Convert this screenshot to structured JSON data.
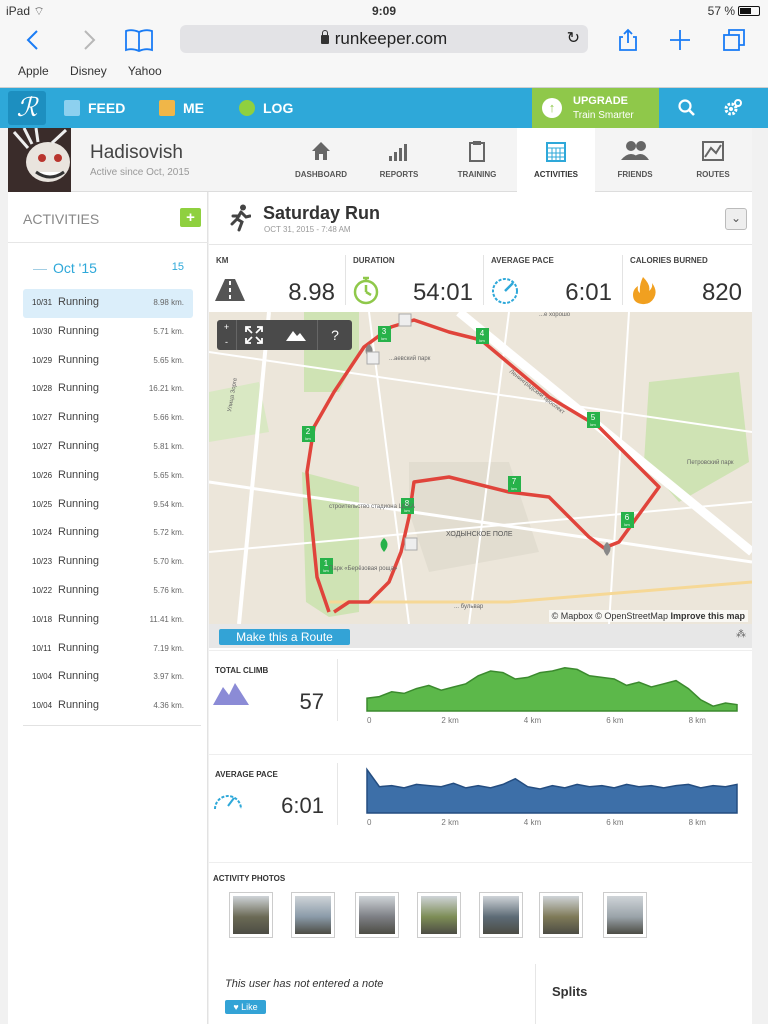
{
  "device": {
    "carrier": "iPad",
    "time": "9:09",
    "battery": "57 %",
    "battery_level": 0.57
  },
  "browser": {
    "url": "runkeeper.com",
    "bookmarks": [
      "Apple",
      "Disney",
      "Yahoo"
    ]
  },
  "header": {
    "nav": [
      {
        "label": "FEED",
        "icon": "feed-icon"
      },
      {
        "label": "ME",
        "icon": "me-icon"
      },
      {
        "label": "LOG",
        "icon": "log-icon"
      }
    ],
    "upgrade": {
      "title": "UPGRADE",
      "subtitle": "Train Smarter"
    },
    "colors": {
      "brand": "#2ea8d9",
      "upgrade": "#8fc84a",
      "route": "#d9403a",
      "climb": "#5cb84a",
      "pace": "#3d6fa8"
    }
  },
  "profile": {
    "name": "Hadisovish",
    "since": "Active since Oct, 2015"
  },
  "tabs": [
    {
      "label": "DASHBOARD",
      "icon": "home-icon"
    },
    {
      "label": "REPORTS",
      "icon": "bar-chart-icon"
    },
    {
      "label": "TRAINING",
      "icon": "clipboard-icon"
    },
    {
      "label": "ACTIVITIES",
      "icon": "calendar-icon",
      "active": true
    },
    {
      "label": "FRIENDS",
      "icon": "people-icon"
    },
    {
      "label": "ROUTES",
      "icon": "map-icon"
    }
  ],
  "sidebar": {
    "title": "ACTIVITIES",
    "add_label": "+",
    "month": {
      "label": "Oct '15",
      "count": "15",
      "prefix": "—"
    },
    "activities": [
      {
        "date": "10/31",
        "type": "Running",
        "km": "8.98 km."
      },
      {
        "date": "10/30",
        "type": "Running",
        "km": "5.71 km."
      },
      {
        "date": "10/29",
        "type": "Running",
        "km": "5.65 km."
      },
      {
        "date": "10/28",
        "type": "Running",
        "km": "16.21 km."
      },
      {
        "date": "10/27",
        "type": "Running",
        "km": "5.66 km."
      },
      {
        "date": "10/27",
        "type": "Running",
        "km": "5.81 km."
      },
      {
        "date": "10/26",
        "type": "Running",
        "km": "5.65 km."
      },
      {
        "date": "10/25",
        "type": "Running",
        "km": "9.54 km."
      },
      {
        "date": "10/24",
        "type": "Running",
        "km": "5.72 km."
      },
      {
        "date": "10/23",
        "type": "Running",
        "km": "5.70 km."
      },
      {
        "date": "10/22",
        "type": "Running",
        "km": "5.76 km."
      },
      {
        "date": "10/18",
        "type": "Running",
        "km": "11.41 km."
      },
      {
        "date": "10/11",
        "type": "Running",
        "km": "7.19 km."
      },
      {
        "date": "10/04",
        "type": "Running",
        "km": "3.97 km."
      },
      {
        "date": "10/04",
        "type": "Running",
        "km": "4.36 km."
      }
    ]
  },
  "activity": {
    "title": "Saturday Run",
    "date": "OCT 31, 2015  -  7:48 AM",
    "stats": [
      {
        "label": "KM",
        "value": "8.98",
        "icon": "road-icon"
      },
      {
        "label": "DURATION",
        "value": "54:01",
        "icon": "stopwatch-icon"
      },
      {
        "label": "AVERAGE PACE",
        "value": "6:01",
        "icon": "speedometer-icon"
      },
      {
        "label": "CALORIES BURNED",
        "value": "820",
        "icon": "flame-icon"
      }
    ],
    "map": {
      "controls": [
        "+",
        "-",
        "?"
      ],
      "km_markers": [
        "1",
        "2",
        "3",
        "4",
        "5",
        "6",
        "7",
        "8"
      ],
      "km_unit": "km",
      "labels": {
        "park1": "...аевский парк",
        "stadium": "строительство стадиона ЦСКА",
        "field": "ХОДЫНСКОЕ ПОЛЕ",
        "park2": "Петровский парк",
        "park3": "Парк «Берёзовая роща»",
        "street1": "Ленинградский проспект",
        "street2": "Улица Зорге",
        "street3": "... бульвар",
        "street4": "...е хорошо"
      },
      "attribution": "© Mapbox © OpenStreetMap",
      "attribution_link": "Improve this map"
    },
    "route_button": "Make this a Route",
    "paw": "⁂",
    "total_climb": {
      "label": "TOTAL CLIMB",
      "value": "57"
    },
    "average_pace": {
      "label": "AVERAGE PACE",
      "value": "6:01"
    },
    "photos_label": "ACTIVITY PHOTOS",
    "photos": [
      {
        "color": "#6b6a55"
      },
      {
        "color": "#8a9aa8"
      },
      {
        "color": "#7d7f84"
      },
      {
        "color": "#7d8d56"
      },
      {
        "color": "#5d6b76"
      },
      {
        "color": "#7f7a58"
      },
      {
        "color": "#9aa3a9"
      }
    ],
    "note": "This user has not entered a note",
    "like": "Like",
    "splits": "Splits"
  },
  "chart_data": [
    {
      "type": "area",
      "title": "TOTAL CLIMB",
      "x_ticks": [
        "0",
        "2 km",
        "4 km",
        "6 km",
        "8 km"
      ],
      "xlim": [
        0,
        8.98
      ],
      "x": [
        0,
        0.3,
        0.6,
        0.9,
        1.2,
        1.5,
        1.8,
        2.1,
        2.4,
        2.7,
        3.0,
        3.3,
        3.6,
        3.9,
        4.2,
        4.5,
        4.8,
        5.1,
        5.4,
        5.7,
        6.0,
        6.3,
        6.6,
        6.9,
        7.2,
        7.5,
        7.8,
        8.1,
        8.4,
        8.7,
        8.98
      ],
      "values": [
        8,
        9,
        12,
        11,
        14,
        16,
        13,
        15,
        17,
        22,
        25,
        24,
        20,
        21,
        24,
        25,
        27,
        26,
        22,
        21,
        20,
        16,
        18,
        15,
        17,
        19,
        14,
        7,
        3,
        5,
        4
      ],
      "color": "#5cb84a"
    },
    {
      "type": "area",
      "title": "AVERAGE PACE",
      "x_ticks": [
        "0",
        "2 km",
        "4 km",
        "6 km",
        "8 km"
      ],
      "xlim": [
        0,
        8.98
      ],
      "x": [
        0,
        0.3,
        0.6,
        0.9,
        1.2,
        1.5,
        1.8,
        2.1,
        2.4,
        2.7,
        3.0,
        3.3,
        3.6,
        3.9,
        4.2,
        4.5,
        4.8,
        5.1,
        5.4,
        5.7,
        6.0,
        6.3,
        6.6,
        6.9,
        7.2,
        7.5,
        7.8,
        8.1,
        8.4,
        8.7,
        8.98
      ],
      "values": [
        38,
        23,
        24,
        22,
        25,
        24,
        23,
        26,
        22,
        24,
        22,
        25,
        30,
        23,
        21,
        24,
        22,
        25,
        23,
        24,
        22,
        25,
        23,
        24,
        22,
        24,
        25,
        22,
        24,
        23,
        25
      ],
      "color": "#3d6fa8"
    }
  ]
}
